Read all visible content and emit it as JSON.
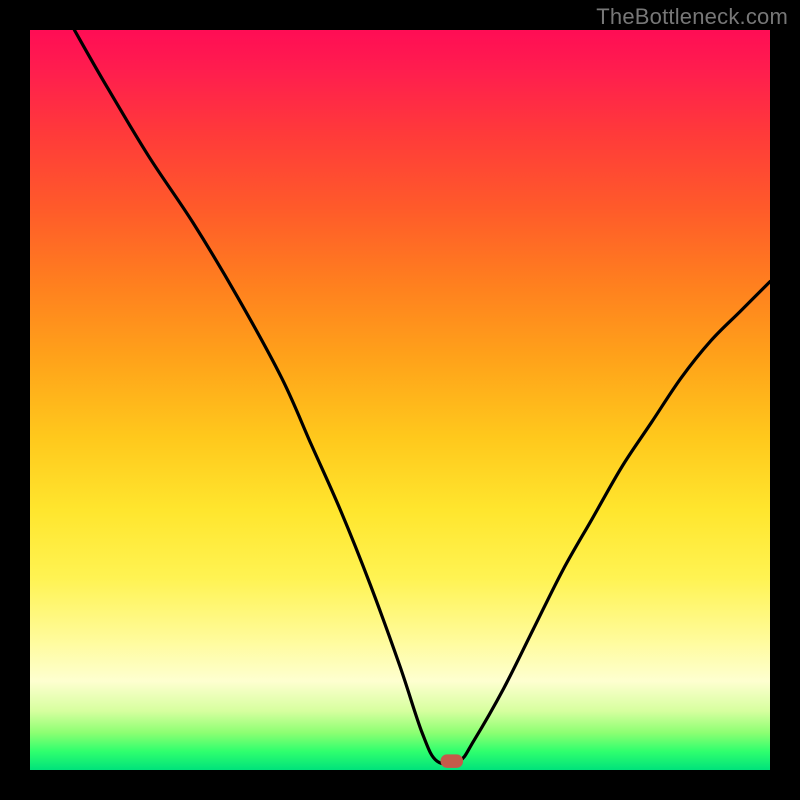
{
  "watermark": "TheBottleneck.com",
  "colors": {
    "page_bg": "#000000",
    "curve": "#000000",
    "marker": "#c55a4a",
    "gradient_stops": [
      "#ff0d55",
      "#ff1f4d",
      "#ff3a3a",
      "#ff5a2a",
      "#ff7e1f",
      "#ffa11a",
      "#ffc81c",
      "#ffe62e",
      "#fff352",
      "#fffb97",
      "#feffd0",
      "#d7ff9f",
      "#8cff72",
      "#2fff6e",
      "#00e27b"
    ]
  },
  "chart_data": {
    "type": "line",
    "title": "",
    "xlabel": "",
    "ylabel": "",
    "xlim": [
      0,
      100
    ],
    "ylim": [
      0,
      100
    ],
    "note": "x and y are normalized 0–100 of plot-area width/height; y=0 is bottom (green), y=100 is top (red). Curve traces a V-shaped bottleneck profile with minimum plateau near x≈55–58 at y≈1.",
    "series": [
      {
        "name": "bottleneck-curve",
        "x": [
          6.0,
          10.0,
          16.0,
          22.0,
          28.0,
          34.0,
          38.0,
          42.0,
          46.0,
          50.0,
          53.0,
          55.0,
          58.0,
          60.0,
          64.0,
          68.0,
          72.0,
          76.0,
          80.0,
          84.0,
          88.0,
          92.0,
          96.0,
          100.0
        ],
        "y": [
          100.0,
          93.0,
          83.0,
          74.0,
          64.0,
          53.0,
          44.0,
          35.0,
          25.0,
          14.0,
          5.0,
          1.2,
          1.2,
          4.0,
          11.0,
          19.0,
          27.0,
          34.0,
          41.0,
          47.0,
          53.0,
          58.0,
          62.0,
          66.0
        ]
      }
    ],
    "marker": {
      "x": 57.0,
      "y": 1.2,
      "shape": "rounded-pill"
    }
  }
}
